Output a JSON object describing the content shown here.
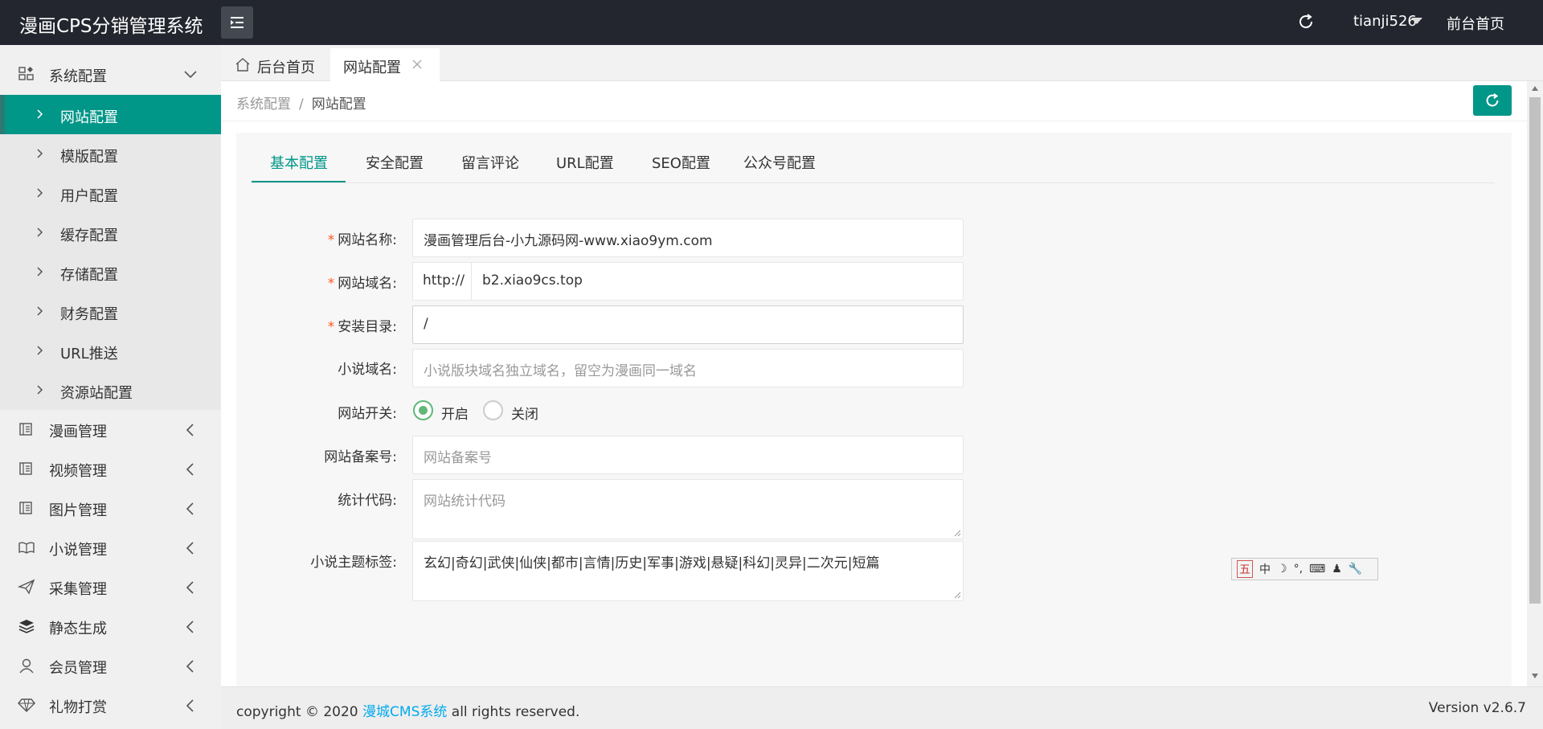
{
  "header": {
    "brand": "漫画CPS分销管理系统",
    "username": "tianji526",
    "front_link": "前台首页"
  },
  "sidebar": {
    "groups": [
      {
        "label": "系统配置",
        "icon": "grid-icon",
        "expanded": true
      },
      {
        "label": "漫画管理",
        "icon": "book-icon"
      },
      {
        "label": "视频管理",
        "icon": "book-icon"
      },
      {
        "label": "图片管理",
        "icon": "book-icon"
      },
      {
        "label": "小说管理",
        "icon": "open-book-icon"
      },
      {
        "label": "采集管理",
        "icon": "send-icon"
      },
      {
        "label": "静态生成",
        "icon": "layers-icon"
      },
      {
        "label": "会员管理",
        "icon": "user-icon"
      },
      {
        "label": "礼物打赏",
        "icon": "diamond-icon"
      }
    ],
    "sub_items": [
      {
        "label": "网站配置",
        "active": true
      },
      {
        "label": "模版配置"
      },
      {
        "label": "用户配置"
      },
      {
        "label": "缓存配置"
      },
      {
        "label": "存储配置"
      },
      {
        "label": "财务配置"
      },
      {
        "label": "URL推送"
      },
      {
        "label": "资源站配置"
      }
    ]
  },
  "tabs": {
    "home": "后台首页",
    "active": "网站配置"
  },
  "breadcrumb": {
    "parent": "系统配置",
    "separator": "/",
    "current": "网站配置"
  },
  "config_tabs": [
    "基本配置",
    "安全配置",
    "留言评论",
    "URL配置",
    "SEO配置",
    "公众号配置"
  ],
  "form": {
    "site_name": {
      "label": "网站名称:",
      "value": "漫画管理后台-小九源码网-www.xiao9ym.com"
    },
    "site_domain": {
      "label": "网站域名:",
      "prefix": "http://",
      "value": "b2.xiao9cs.top"
    },
    "install_dir": {
      "label": "安装目录:",
      "value": "/"
    },
    "novel_domain": {
      "label": "小说域名:",
      "placeholder": "小说版块域名独立域名，留空为漫画同一域名"
    },
    "site_switch": {
      "label": "网站开关:",
      "on": "开启",
      "off": "关闭",
      "selected": "开启"
    },
    "icp": {
      "label": "网站备案号:",
      "placeholder": "网站备案号"
    },
    "stats_code": {
      "label": "统计代码:",
      "placeholder": "网站统计代码"
    },
    "novel_tags": {
      "label": "小说主题标签:",
      "value": "玄幻|奇幻|武侠|仙侠|都市|言情|历史|军事|游戏|悬疑|科幻|灵异|二次元|短篇"
    }
  },
  "ime_toolbar": {
    "items": [
      "五",
      "中",
      "☽",
      "°,",
      "⌨",
      "♟",
      "🔧"
    ]
  },
  "footer": {
    "copy_prefix": "copyright © 2020 ",
    "copy_link": "漫城CMS系统",
    "copy_suffix": " all rights reserved.",
    "version": "Version v2.6.7"
  },
  "colors": {
    "accent": "#009688",
    "topbar": "#23262e",
    "required": "#ff5722",
    "radio": "#5fb878"
  }
}
